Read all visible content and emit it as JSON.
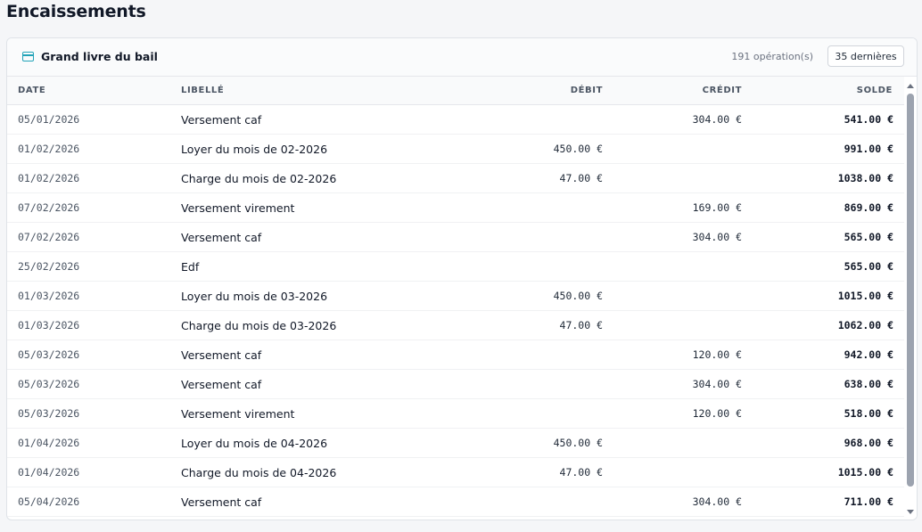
{
  "page": {
    "title": "Encaissements"
  },
  "ledger": {
    "title": "Grand livre du bail",
    "icon": "card-icon",
    "operations_count": "191 opération(s)",
    "last_button": "35 dernières",
    "columns": {
      "date": "DATE",
      "label": "LIBELLÉ",
      "debit": "DÉBIT",
      "credit": "CRÉDIT",
      "balance": "SOLDE"
    },
    "rows": [
      {
        "date": "05/01/2026",
        "label": "Versement caf",
        "debit": "",
        "credit": "304.00 €",
        "balance": "541.00 €"
      },
      {
        "date": "01/02/2026",
        "label": "Loyer du mois de 02-2026",
        "debit": "450.00 €",
        "credit": "",
        "balance": "991.00 €"
      },
      {
        "date": "01/02/2026",
        "label": "Charge du mois de 02-2026",
        "debit": "47.00 €",
        "credit": "",
        "balance": "1038.00 €"
      },
      {
        "date": "07/02/2026",
        "label": "Versement virement",
        "debit": "",
        "credit": "169.00 €",
        "balance": "869.00 €"
      },
      {
        "date": "07/02/2026",
        "label": "Versement caf",
        "debit": "",
        "credit": "304.00 €",
        "balance": "565.00 €"
      },
      {
        "date": "25/02/2026",
        "label": "Edf",
        "debit": "",
        "credit": "",
        "balance": "565.00 €"
      },
      {
        "date": "01/03/2026",
        "label": "Loyer du mois de 03-2026",
        "debit": "450.00 €",
        "credit": "",
        "balance": "1015.00 €"
      },
      {
        "date": "01/03/2026",
        "label": "Charge du mois de 03-2026",
        "debit": "47.00 €",
        "credit": "",
        "balance": "1062.00 €"
      },
      {
        "date": "05/03/2026",
        "label": "Versement caf",
        "debit": "",
        "credit": "120.00 €",
        "balance": "942.00 €"
      },
      {
        "date": "05/03/2026",
        "label": "Versement caf",
        "debit": "",
        "credit": "304.00 €",
        "balance": "638.00 €"
      },
      {
        "date": "05/03/2026",
        "label": "Versement virement",
        "debit": "",
        "credit": "120.00 €",
        "balance": "518.00 €"
      },
      {
        "date": "01/04/2026",
        "label": "Loyer du mois de 04-2026",
        "debit": "450.00 €",
        "credit": "",
        "balance": "968.00 €"
      },
      {
        "date": "01/04/2026",
        "label": "Charge du mois de 04-2026",
        "debit": "47.00 €",
        "credit": "",
        "balance": "1015.00 €"
      },
      {
        "date": "05/04/2026",
        "label": "Versement caf",
        "debit": "",
        "credit": "304.00 €",
        "balance": "711.00 €"
      }
    ]
  }
}
